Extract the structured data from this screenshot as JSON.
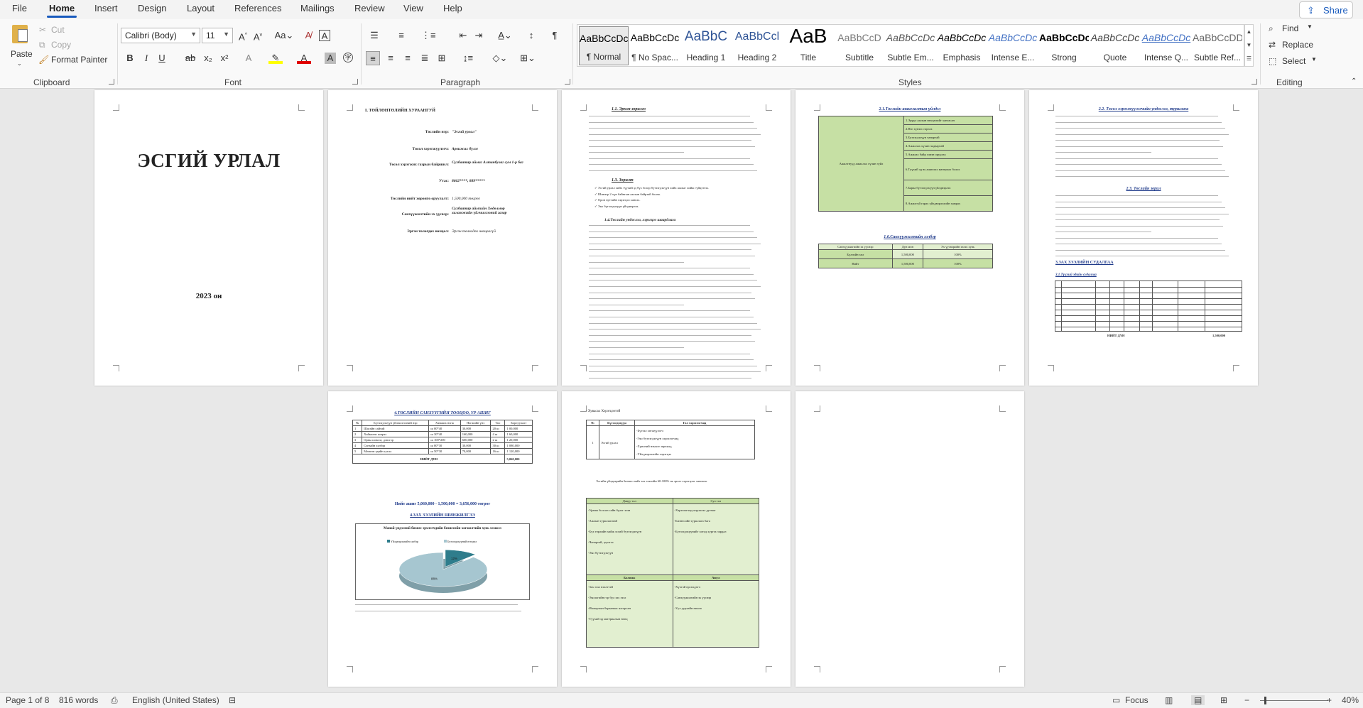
{
  "menu": {
    "tabs": [
      "File",
      "Home",
      "Insert",
      "Design",
      "Layout",
      "References",
      "Mailings",
      "Review",
      "View",
      "Help"
    ],
    "share": "Share"
  },
  "ribbon": {
    "clipboard": {
      "paste": "Paste",
      "cut": "Cut",
      "copy": "Copy",
      "format_painter": "Format Painter",
      "label": "Clipboard"
    },
    "font": {
      "name": "Calibri (Body)",
      "size": "11",
      "label": "Font"
    },
    "paragraph": {
      "label": "Paragraph"
    },
    "styles": {
      "label": "Styles",
      "items": [
        {
          "preview": "AaBbCcDc",
          "name": "¶ Normal"
        },
        {
          "preview": "AaBbCcDc",
          "name": "¶ No Spac..."
        },
        {
          "preview": "AaBbC",
          "name": "Heading 1"
        },
        {
          "preview": "AaBbCcl",
          "name": "Heading 2"
        },
        {
          "preview": "AaB",
          "name": "Title"
        },
        {
          "preview": "AaBbCcD",
          "name": "Subtitle"
        },
        {
          "preview": "AaBbCcDc",
          "name": "Subtle Em..."
        },
        {
          "preview": "AaBbCcDc",
          "name": "Emphasis"
        },
        {
          "preview": "AaBbCcDc",
          "name": "Intense E..."
        },
        {
          "preview": "AaBbCcDc",
          "name": "Strong"
        },
        {
          "preview": "AaBbCcDc",
          "name": "Quote"
        },
        {
          "preview": "AaBbCcDc",
          "name": "Intense Q..."
        },
        {
          "preview": "AaBbCcDD",
          "name": "Subtle Ref..."
        }
      ]
    },
    "editing": {
      "find": "Find",
      "replace": "Replace",
      "select": "Select",
      "label": "Editing"
    }
  },
  "pages": {
    "p1": {
      "title": "ЭСГИЙ УРЛАЛ",
      "year": "2023 он"
    },
    "p2": {
      "heading": "I.      ТӨЙЛӨНТӨЛИЙН ХУРААНГУЙ",
      "rows": [
        {
          "k": "Төслийн нэр:",
          "v": "\"Эсгий урлал\""
        },
        {
          "k": "Төсөл хэрэгжүүлэгч:",
          "v": "Арвижих бүлэг"
        },
        {
          "k": "Төсөл хэрэгжих газрын байршил:",
          "v": "Сүхбаатар аймаг Алтанбулаг сум 1-р баг"
        },
        {
          "k": "Утас:",
          "v": "8662****, 889*****"
        },
        {
          "k": "Төслийн нийт хөрөнгө оруулалт:",
          "v": "1,500,000 төгрөг"
        },
        {
          "k": "Санхүүжилтийн эх үүсвэр:",
          "v": "Сүхбаатар аймгийн Хөдөлмөр халамжийн үйлчилгээний газар"
        },
        {
          "k": "Эргэн төлөгдөх нөхцөл:",
          "v": "Эргэн төлөгдөх нөхцөлгүй"
        }
      ]
    },
    "p3": {
      "h1": "1.1.    Эрхэм зорилго",
      "h2": "1.3.    Зорилт",
      "h3": "1.4.Төслийн ундэслэл, хэрэгцээ шаардлага",
      "bullets": [
        "Эсгий урлал хийх түүхий эд бүх ёсоор бүтээгдэхүүн хийх ажлыг хийж гүйцэтгэх.",
        "Шинээр 2 хүн байнгын ажлын байртай болно.",
        "Орон нутгийн хэрэгцээ хангах.",
        "Эко бүтээгдэхүүн үйлдвэрлэх."
      ]
    },
    "p4": {
      "h1": "2.1.Төслийн ашиглалтын үйлдэл",
      "left": "Ажилтнууд ажиллах хүчин зүйл",
      "h2": "1.6.Санхүүжилтийн хэлбэр",
      "list": [
        "1.Эрүүл ажлын нөхцөлийг хангасан",
        "2.Нэг хүнээс гаргах",
        "3.Бүтээгдэхүүн чанартай",
        "4.Ажиллах хүчин чадвартай",
        "5.Ажилах байр хэвэн оруулах",
        "6.Түүхий эд нь ашиглах материал болох",
        "7.Бараа бүтээгдэхүүн үйлдвэрлэх",
        "8.Ажилгүй гарах үйлдвэрлэлийн хамрах"
      ],
      "fin_head": [
        "Санхүүжилтийн эх үүсвэр",
        "Дүн мөн",
        "Эх үүсвэрийн эзлэх хувь"
      ],
      "fin_rows": [
        [
          "Бүлгийн хөл",
          "1,500,000",
          "100%"
        ],
        [
          "Нийт",
          "1,500,000",
          "100%"
        ]
      ]
    },
    "p5": {
      "h1": "2.2. Төсөл хэрэгжүүлэгчийн ундэслэл, туршлага",
      "h2": "2.3. Төслийн зорил",
      "h3": "3.ЗАХ ЗЭЭЛИЙН СУДАЛГАА",
      "h4": "3.1.Түүхий эдийн судалгаа",
      "total_label": "НИЙТ ДҮН",
      "total": "1,500,000"
    },
    "p6": {
      "h1": "4.ТӨСЛИЙН САНХҮҮГИЙН ТООЦОО, ҮР АШИГ",
      "head": [
        "№",
        "Бүтээгдэхүүн үйлчилгээний нэр",
        "Хэмжих нэгж",
        "Нэгжийн үнэ",
        "Тоо",
        "Борлуулалт"
      ],
      "rows": [
        [
          "1",
          "Шагайн сайтай",
          "ш 00*40",
          "30,000",
          "20 ш",
          "1 00,000"
        ],
        [
          "2",
          "Хайкпенс ширээ",
          "ш 30*40",
          "160,000",
          "4 ш",
          "1 60,000"
        ],
        [
          "3",
          "Орны шэвлэг, дэвсгэр",
          "ш 100*200",
          "600,000",
          "2 ш",
          "1 20,000"
        ],
        [
          "4",
          "Сэнзайн хэлбэр",
          "ш 00*30",
          "30,000",
          "30 ш",
          "1 080,000"
        ],
        [
          "5",
          "Мөнгөн эдийн гутал",
          "ш 50*30",
          "70,000",
          "16 ш",
          "1 120,000"
        ]
      ],
      "total_label": "НИЙТ ДҮН",
      "total": "5,060,000",
      "net": "Нийт ашиг 5,060,000 - 1,500,000 = 3,656,000 төгрөг",
      "h2": "4.ЗАХ ЗЭЭЛИЙН ШИНЖИЛГЭЭ",
      "chart_title": "Манай үндэсний бизнес эрхлэгчдийн бизнесийн хөгжилтийн хувь хэмжээ",
      "leg1": "Үйлдвэрлэлийн хэлбэр",
      "leg2": "Бүтээгдэхүүний өгөгдөл",
      "chart_data": {
        "type": "pie",
        "categories": [
          "Үйлдвэрлэлийн хэлбэр",
          "Бүтээгдэхүүний өгөгдөл"
        ],
        "values": [
          12,
          88
        ],
        "labels": [
          "12%",
          "88%"
        ]
      }
    },
    "p7": {
      "lead": "- Хувьсах Хэрэгцээтэй",
      "t1_head": [
        "№",
        "Бүтээгдэхүүн",
        "Гол хэрэглэгчид"
      ],
      "t1_row": [
        "1",
        "Эсгий урлал"
      ],
      "t1_items": [
        "-Бүтээл хөгжүүлэгч",
        "-Эко бүтээгдэхүүн хэрэглэгчид",
        "-Хүнсний нэмэлт зөрчилд",
        "-Үйлдвэрлэлийн хэрэгцээ"
      ],
      "para": "Эсгийн үйлдвэрийн бизнес нийт зах зээлийн 60-100% нь эрэлт хэрэгцээг хангана.",
      "swot": {
        "s": "Давуу тал",
        "w": "Сул тал",
        "o": "Боломж",
        "t": "Аюул",
        "s_items": [
          "-Ураны болсон сайн бүлэг эзэн",
          "-Ажлын туршлагатай",
          "-Бүх төрлийн хийж эсгий бүтээгдэхүүн",
          "-Чанартай, эдэлгээ",
          "-Эко бүтээгдэхүүн"
        ],
        "w_items": [
          "-Хэрэглэгчид мэдээлэл дутмаг",
          "-Бизнесийн туршлага бага",
          "-Бүтээгдэхүүнийг хотод хүргэх зардал"
        ],
        "o_items": [
          "-Зах зээл нээлттэй",
          "-Экологийн гэр бүл зах зээл",
          "-Импортын бараанаас ялгарсан",
          "-Түүхий эд материалын нөөц"
        ],
        "t_items": [
          "-Хүчтэй өрсөлдөгч",
          "-Санхүүжилтийн эх үүсвэр",
          "-Уул уурхайн нөлөө"
        ]
      }
    }
  },
  "status": {
    "page": "Page 1 of 8",
    "words": "816 words",
    "language": "English (United States)",
    "focus": "Focus",
    "zoom": "40%"
  }
}
